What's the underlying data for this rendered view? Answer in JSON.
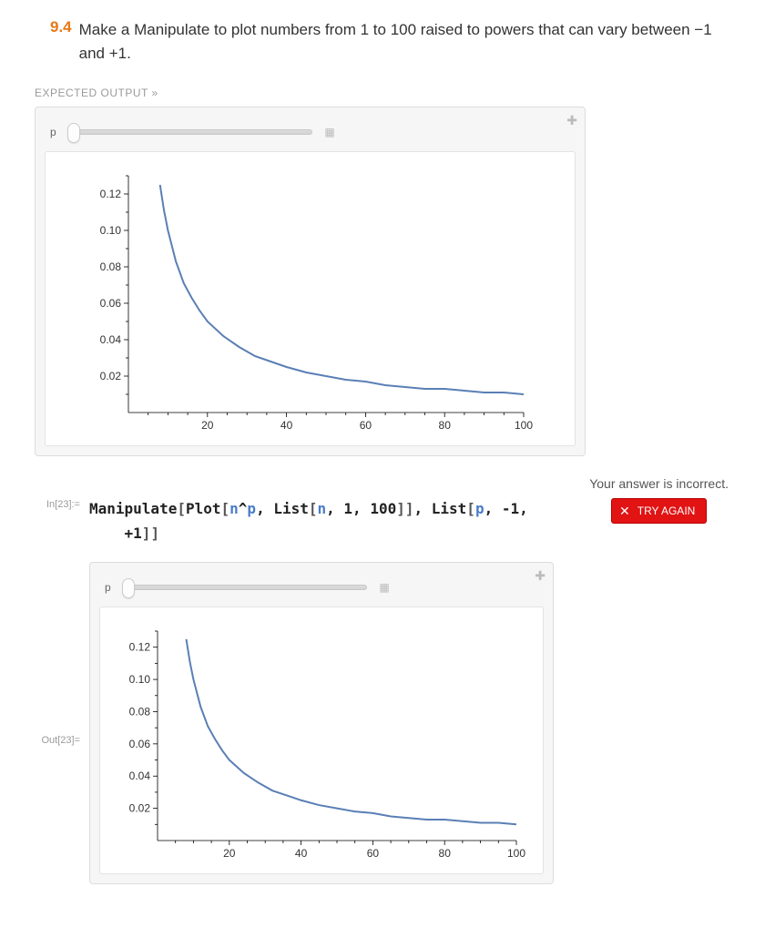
{
  "exercise": {
    "number": "9.4",
    "text": "Make a Manipulate to plot numbers from 1 to 100 raised to powers that can vary between −1 and +1."
  },
  "expected_label": "EXPECTED OUTPUT",
  "slider": {
    "label": "p"
  },
  "feedback": {
    "message": "Your answer is incorrect."
  },
  "input": {
    "label": "In[23]:=",
    "code_tokens": [
      {
        "t": "func",
        "v": "Manipulate"
      },
      {
        "t": "brack",
        "v": "["
      },
      {
        "t": "func",
        "v": "Plot"
      },
      {
        "t": "brack",
        "v": "["
      },
      {
        "t": "sym",
        "v": "n"
      },
      {
        "t": "op",
        "v": "^"
      },
      {
        "t": "sym",
        "v": "p"
      },
      {
        "t": "op",
        "v": ", "
      },
      {
        "t": "func",
        "v": "List"
      },
      {
        "t": "brack",
        "v": "["
      },
      {
        "t": "sym",
        "v": "n"
      },
      {
        "t": "op",
        "v": ", "
      },
      {
        "t": "num",
        "v": "1"
      },
      {
        "t": "op",
        "v": ", "
      },
      {
        "t": "num",
        "v": "100"
      },
      {
        "t": "brack",
        "v": "]"
      },
      {
        "t": "brack",
        "v": "]"
      },
      {
        "t": "op",
        "v": ", "
      },
      {
        "t": "func",
        "v": "List"
      },
      {
        "t": "brack",
        "v": "["
      },
      {
        "t": "sym",
        "v": "p"
      },
      {
        "t": "op",
        "v": ", "
      },
      {
        "t": "num",
        "v": "-1"
      },
      {
        "t": "op",
        "v": ", "
      },
      {
        "t": "br",
        "v": ""
      },
      {
        "t": "num",
        "v": "+1"
      },
      {
        "t": "brack",
        "v": "]"
      },
      {
        "t": "brack",
        "v": "]"
      }
    ]
  },
  "output": {
    "label": "Out[23]="
  },
  "try_again": {
    "label": "TRY AGAIN"
  },
  "chart_data": {
    "type": "line",
    "title": "",
    "xlabel": "",
    "ylabel": "",
    "xlim": [
      0,
      100
    ],
    "ylim": [
      0,
      0.13
    ],
    "x_ticks": [
      20,
      40,
      60,
      80,
      100
    ],
    "y_ticks": [
      0.02,
      0.04,
      0.06,
      0.08,
      0.1,
      0.12
    ],
    "series": [
      {
        "name": "n^-1",
        "x": [
          8,
          9,
          10,
          12,
          14,
          16,
          18,
          20,
          24,
          28,
          32,
          36,
          40,
          45,
          50,
          55,
          60,
          65,
          70,
          75,
          80,
          85,
          90,
          95,
          100
        ],
        "y": [
          0.125,
          0.111,
          0.1,
          0.083,
          0.071,
          0.063,
          0.056,
          0.05,
          0.042,
          0.036,
          0.031,
          0.028,
          0.025,
          0.022,
          0.02,
          0.018,
          0.017,
          0.015,
          0.014,
          0.013,
          0.013,
          0.012,
          0.011,
          0.011,
          0.01
        ]
      }
    ]
  }
}
